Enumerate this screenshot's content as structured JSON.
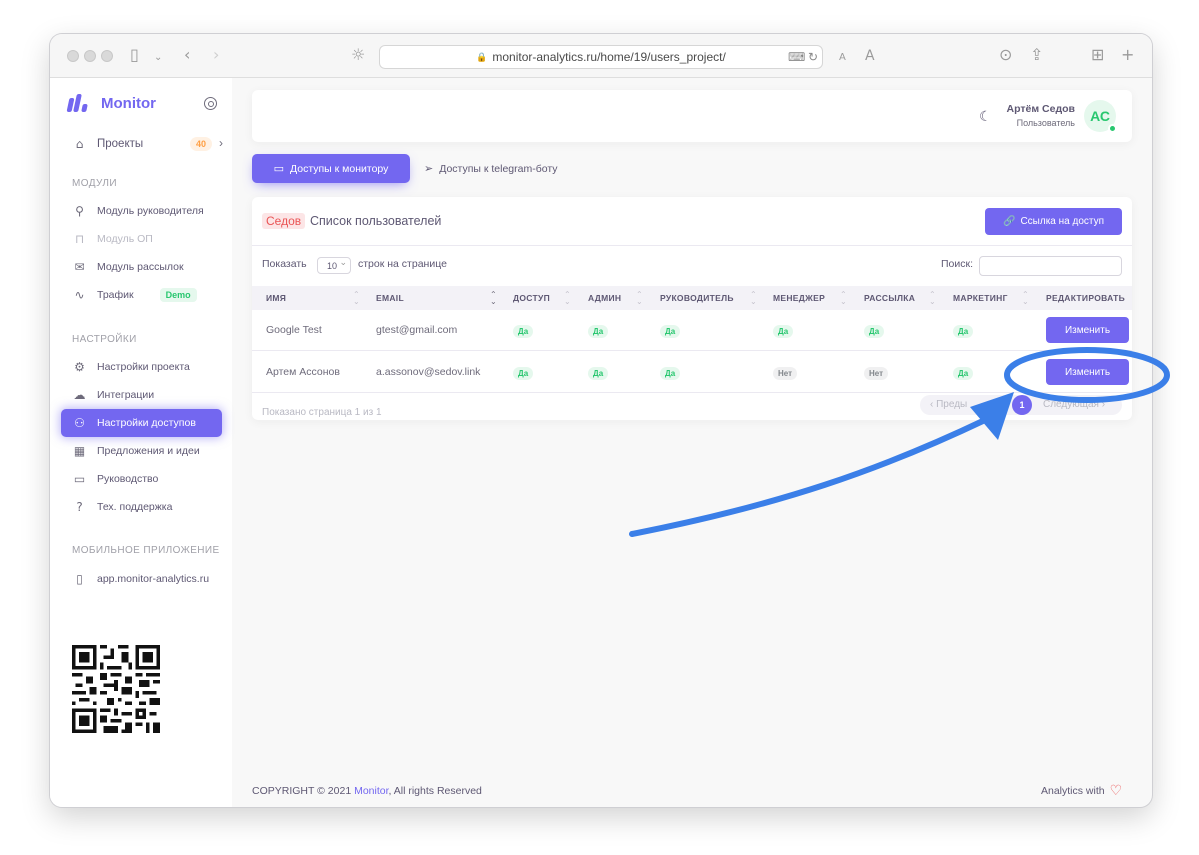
{
  "browser": {
    "url_host": "monitor-analytics.ru",
    "url_path": "/home/19/users_project/",
    "reader_small": "A",
    "reader_large": "A"
  },
  "sidebar": {
    "brand": "Monitor",
    "projects": {
      "label": "Проекты",
      "count": "40"
    },
    "section_modules": "МОДУЛИ",
    "modules": [
      {
        "label": "Модуль руководителя",
        "icon": "user-icon",
        "disabled": false
      },
      {
        "label": "Модуль ОП",
        "icon": "lock-icon",
        "disabled": true
      },
      {
        "label": "Модуль рассылок",
        "icon": "mail-icon",
        "disabled": false
      },
      {
        "label": "Трафик",
        "icon": "activity-icon",
        "disabled": false,
        "badge": "Demo"
      }
    ],
    "section_settings": "НАСТРОЙКИ",
    "settings": [
      {
        "label": "Настройки проекта",
        "icon": "gear-icon"
      },
      {
        "label": "Интеграции",
        "icon": "cloud-icon"
      },
      {
        "label": "Настройки доступов",
        "icon": "users-icon",
        "active": true
      },
      {
        "label": "Предложения и идеи",
        "icon": "trello-icon"
      },
      {
        "label": "Руководство",
        "icon": "monitor-icon"
      },
      {
        "label": "Тех. поддержка",
        "icon": "help-circle-icon"
      }
    ],
    "section_mobile": "МОБИЛЬНОЕ ПРИЛОЖЕНИЕ",
    "mobile_link": "app.monitor-analytics.ru"
  },
  "header": {
    "user_name": "Артём Седов",
    "user_role": "Пользователь",
    "avatar_initials": "АС"
  },
  "tabs": {
    "monitor_access": "Доступы к монитору",
    "telegram_access": "Доступы к telegram-боту"
  },
  "card": {
    "title_tag": "Седов",
    "title": "Список пользователей",
    "access_link_button": "Ссылка на доступ",
    "show_label": "Показать",
    "page_size": "10",
    "rows_label": "строк на странице",
    "search_label": "Поиск:",
    "search_value": "",
    "columns": [
      "ИМЯ",
      "EMAIL",
      "ДОСТУП",
      "АДМИН",
      "РУКОВОДИТЕЛЬ",
      "МЕНЕДЖЕР",
      "РАССЫЛКА",
      "МАРКЕТИНГ",
      "РЕДАКТИРОВАТЬ"
    ],
    "rows": [
      {
        "name": "Google Test",
        "email": "gtest@gmail.com",
        "access": "Да",
        "admin": "Да",
        "manager_head": "Да",
        "manager": "Да",
        "mailing": "Да",
        "marketing": "Да",
        "edit": "Изменить"
      },
      {
        "name": "Артем Ассонов",
        "email": "a.assonov@sedov.link",
        "access": "Да",
        "admin": "Да",
        "manager_head": "Да",
        "manager": "Нет",
        "mailing": "Нет",
        "marketing": "Да",
        "edit": "Изменить"
      }
    ],
    "info": "Показано страница 1 из 1",
    "pager_prev": "‹ Преды",
    "pager_current": "1",
    "pager_next": "Следующая ›"
  },
  "footer": {
    "copyright_prefix": "COPYRIGHT © 2021 ",
    "copyright_brand": "Monitor",
    "copyright_suffix": ", All rights Reserved",
    "analytics_with": "Analytics with"
  },
  "colors": {
    "accent": "#7367f0",
    "success": "#28c76f",
    "danger": "#ea5455",
    "annotation": "#3b7fe8"
  }
}
